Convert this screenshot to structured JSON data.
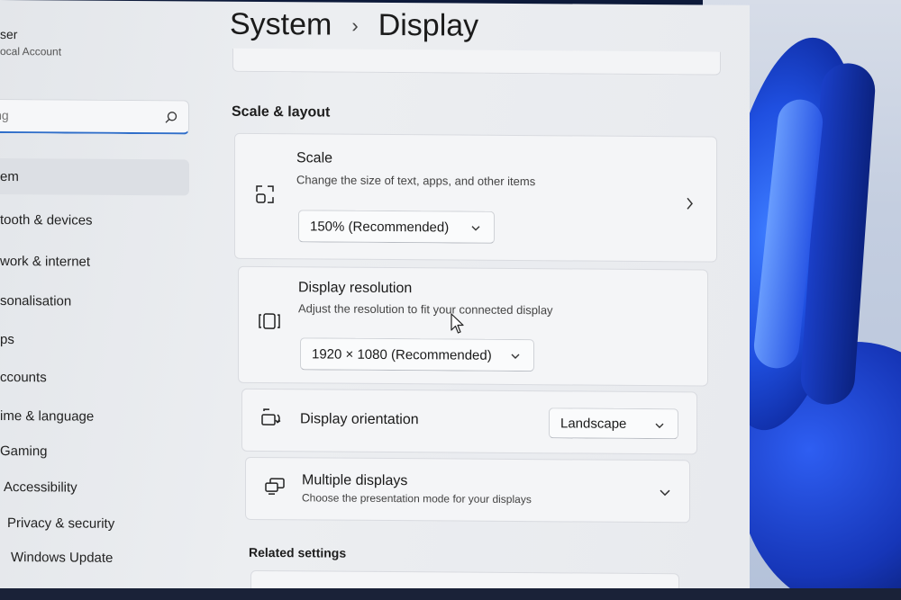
{
  "user": {
    "name": "ser",
    "account_type": "ocal Account"
  },
  "search": {
    "placeholder": "ing"
  },
  "sidebar": {
    "items": [
      {
        "label": "em",
        "icon": "monitor-icon",
        "selected": true
      },
      {
        "label": "tooth & devices",
        "icon": "bluetooth-icon"
      },
      {
        "label": "work & internet",
        "icon": "network-icon"
      },
      {
        "label": "sonalisation",
        "icon": "brush-icon"
      },
      {
        "label": "ps",
        "icon": "apps-icon"
      },
      {
        "label": "ccounts",
        "icon": "person-icon"
      },
      {
        "label": "ime & language",
        "icon": "globe-icon"
      },
      {
        "label": "Gaming",
        "icon": "gamepad-icon"
      },
      {
        "label": "Accessibility",
        "icon": "accessibility-icon"
      },
      {
        "label": "Privacy & security",
        "icon": "shield-icon"
      },
      {
        "label": "Windows Update",
        "icon": "update-icon"
      }
    ]
  },
  "header": {
    "parent": "System",
    "separator": "›",
    "current": "Display"
  },
  "scale_layout": {
    "title": "Scale & layout",
    "scale": {
      "title": "Scale",
      "description": "Change the size of text, apps, and other items",
      "value": "150% (Recommended)"
    },
    "resolution": {
      "title": "Display resolution",
      "description": "Adjust the resolution to fit your connected display",
      "value": "1920 × 1080 (Recommended)"
    },
    "orientation": {
      "title": "Display orientation",
      "value": "Landscape"
    },
    "multiple": {
      "title": "Multiple displays",
      "description": "Choose the presentation mode for your displays"
    }
  },
  "related": {
    "title": "Related settings"
  },
  "colors": {
    "accent": "#2f6ec9",
    "window_bg": "#eceef1",
    "card_bg": "#f4f5f7",
    "wallpaper_blue": "#1f4fe0"
  }
}
